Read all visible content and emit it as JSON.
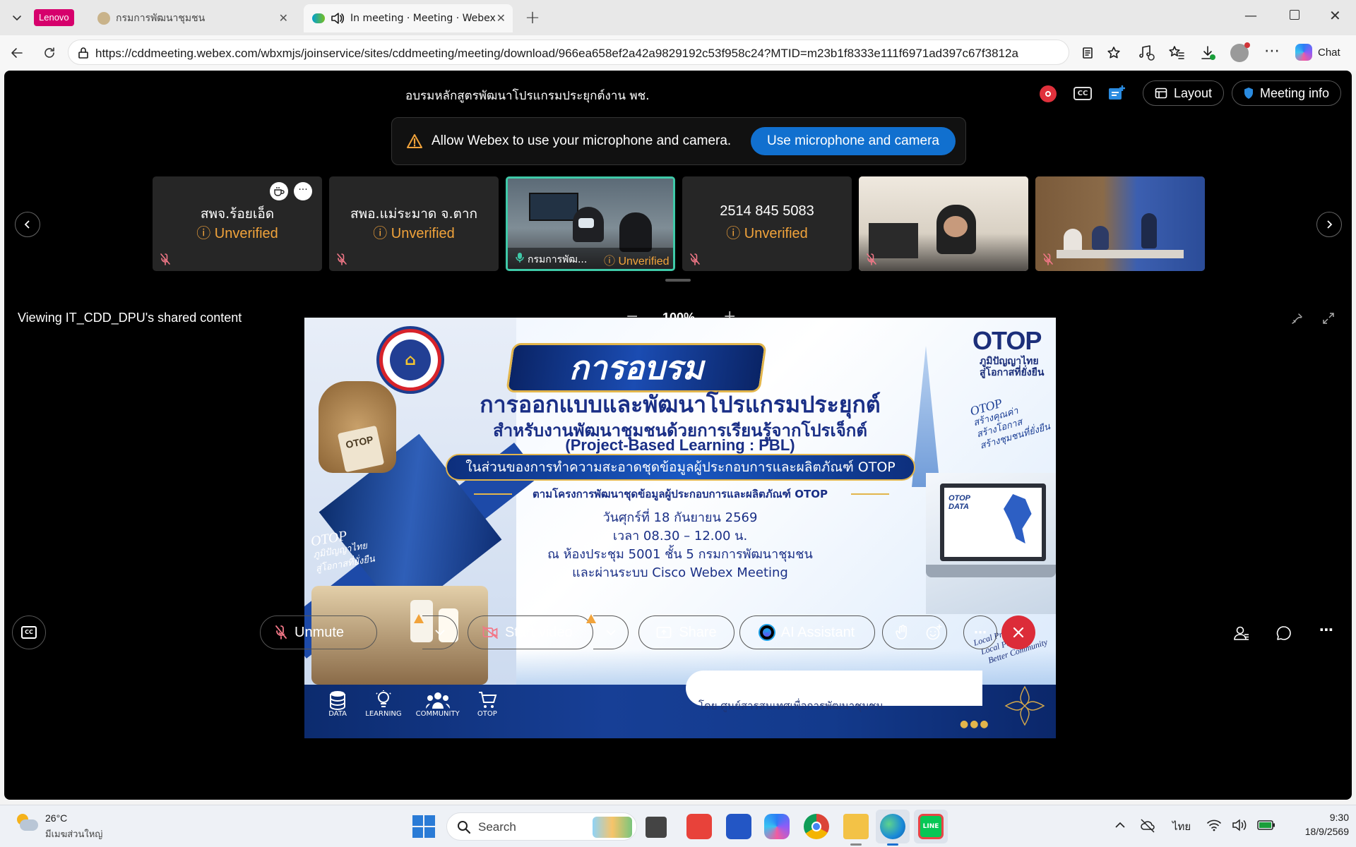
{
  "browser": {
    "profile_badge": "Lenovo",
    "tabs": [
      {
        "title": "กรมการพัฒนาชุมชน"
      },
      {
        "title": "In meeting · Meeting · Webex"
      }
    ],
    "url": "https://cddmeeting.webex.com/wbxmjs/joinservice/sites/cddmeeting/meeting/download/966ea658ef2a42a9829192c53f958c24?MTID=m23b1f8333e111f6971ad397c67f3812a",
    "chat_label": "Chat"
  },
  "meeting": {
    "title": "อบรมหลักสูตรพัฒนาโปรแกรมประยุกต์งาน พช.",
    "layout_label": "Layout",
    "meeting_info_label": "Meeting info",
    "permission_banner": {
      "message": "Allow Webex to use your microphone and camera.",
      "button": "Use microphone and camera"
    },
    "participants": [
      {
        "name": "สพจ.ร้อยเอ็ด",
        "status": "Unverified",
        "type": "avatar"
      },
      {
        "name": "สพอ.แม่ระมาด จ.ตาก",
        "status": "Unverified",
        "type": "avatar"
      },
      {
        "name": "กรมการพัฒ...",
        "status": "Unverified",
        "type": "video"
      },
      {
        "name": "2514 845 5083",
        "status": "Unverified",
        "type": "avatar"
      },
      {
        "name": "",
        "status": "",
        "type": "video"
      },
      {
        "name": "",
        "status": "",
        "type": "video"
      }
    ],
    "shared_label": "Viewing IT_CDD_DPU's shared content",
    "zoom": "100%",
    "controls": {
      "unmute": "Unmute",
      "start_video": "Start video",
      "share": "Share",
      "ai_assistant": "AI Assistant"
    }
  },
  "slide": {
    "headline": "การอบรม",
    "title1": "การออกแบบและพัฒนาโปรแกรมประยุกต์",
    "title2": "สำหรับงานพัฒนาชุมชนด้วยการเรียนรู้จากโปรเจ็กต์",
    "title3": "(Project-Based Learning : PBL)",
    "band": "ในส่วนของการทำความสะอาดชุดข้อมูลผู้ประกอบการและผลิตภัณฑ์ OTOP",
    "project": "ตามโครงการพัฒนาชุดข้อมูลผู้ประกอบการและผลิตภัณฑ์ OTOP",
    "date": "วันศุกร์ที่ 18 กันยายน 2569",
    "time": "เวลา 08.30 – 12.00 น.",
    "place": "ณ ห้องประชุม 5001 ชั้น 5 กรมการพัฒนาชุมชน",
    "online": "และผ่านระบบ Cisco Webex Meeting",
    "otop_logo": "OTOP",
    "otop_tag1": "ภูมิปัญญาไทย",
    "otop_tag2": "สู่โอกาสที่ยั่งยืน",
    "script_right1": "OTOP",
    "script_right2": "สร้างคุณค่า",
    "script_right3": "สร้างโอกาส",
    "script_right4": "สร้างชุมชนที่ยั่งยืน",
    "script_left1": "OTOP",
    "script_left2": "ภูมิปัญญาไทย",
    "script_left3": "สู่โอกาสที่ยั่งยืน",
    "bag_tag": "OTOP",
    "laptop_label1": "OTOP",
    "laptop_label2": "DATA",
    "local1": "Local Product",
    "local2": "Local People",
    "local3": "Better Community",
    "organizer": "โดย  ศูนย์สารสนเทศเพื่อการพัฒนาชุมชน",
    "icons": [
      "DATA",
      "LEARNING",
      "COMMUNITY",
      "OTOP"
    ]
  },
  "taskbar": {
    "weather_temp": "26°C",
    "weather_desc": "มีเมฆส่วนใหญ่",
    "search": "Search",
    "lang": "ไทย",
    "time": "9:30",
    "date": "18/9/2569"
  }
}
